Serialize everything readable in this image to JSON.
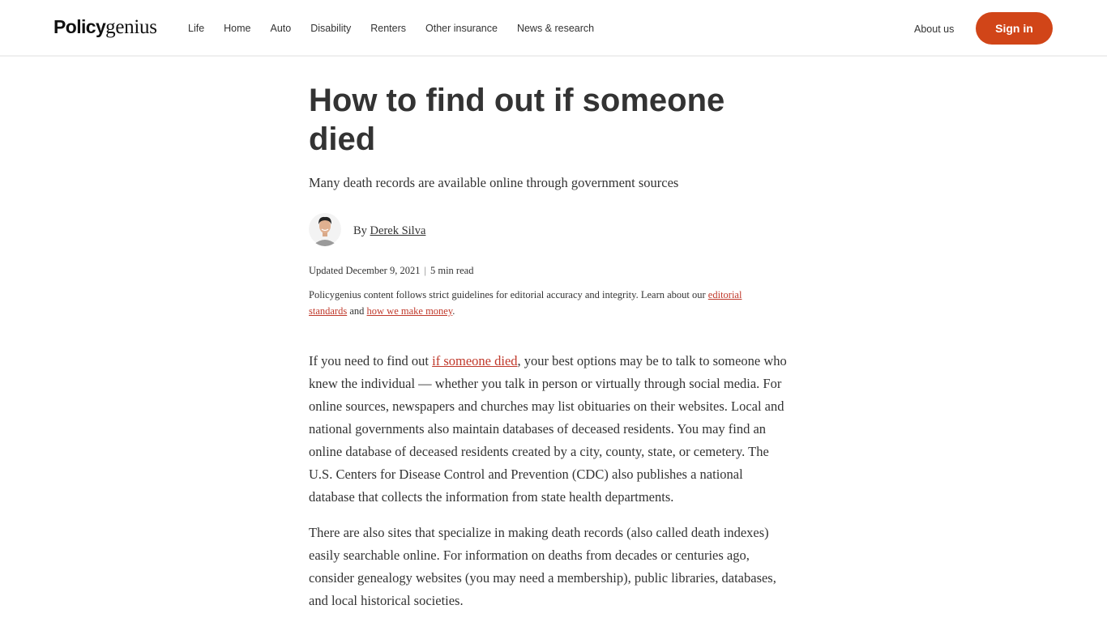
{
  "header": {
    "logo": {
      "bold": "Policy",
      "light": "genius"
    },
    "nav": [
      "Life",
      "Home",
      "Auto",
      "Disability",
      "Renters",
      "Other insurance",
      "News & research"
    ],
    "about_label": "About us",
    "signin_label": "Sign in",
    "accent_color": "#d14518"
  },
  "article": {
    "title": "How to find out if someone died",
    "subtitle": "Many death records are available online through government sources",
    "byline": {
      "prefix": "By",
      "author": "Derek Silva",
      "avatar_icon": "author-avatar"
    },
    "meta": {
      "updated_label": "Updated",
      "date": "December 9, 2021",
      "separator": "|",
      "read_time": "5 min read"
    },
    "disclaimer": {
      "text_before": "Policygenius content follows strict guidelines for editorial accuracy and integrity. Learn about our ",
      "link1": "editorial standards",
      "text_mid": " and ",
      "link2": "how we make money",
      "text_after": "."
    },
    "paragraphs": [
      {
        "before": "If you need to find out ",
        "link": "if someone died",
        "after": ", your best options may be to talk to someone who knew the individual — whether you talk in person or virtually through social media. For online sources, newspapers and churches may list obituaries on their websites. Local and national governments also maintain databases of deceased residents. You may find an online database of deceased residents created by a city, county, state, or cemetery. The U.S. Centers for Disease Control and Prevention (CDC) also publishes a national database that collects the information from state health departments."
      },
      {
        "text": "There are also sites that specialize in making death records (also called death indexes) easily searchable online. For information on deaths from decades or centuries ago, consider genealogy websites (you may need a membership), public libraries, databases, and local historical societies."
      }
    ],
    "link_color": "#c0392b"
  }
}
